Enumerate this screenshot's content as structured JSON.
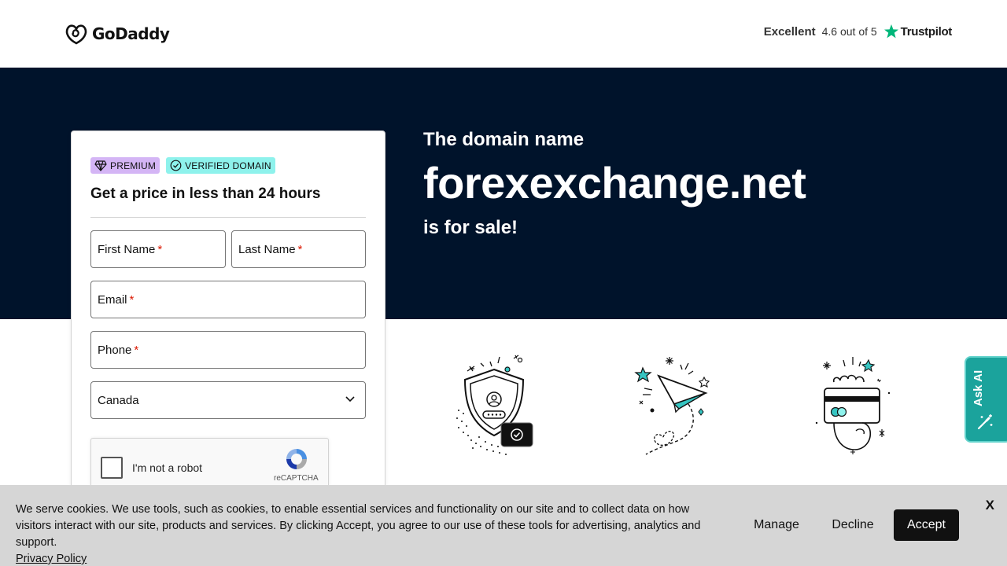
{
  "header": {
    "logo_text": "GoDaddy",
    "trustpilot": {
      "rating_word": "Excellent",
      "score_text": "4.6 out of 5",
      "brand": "Trustpilot"
    }
  },
  "hero": {
    "line1": "The domain name",
    "domain": "forexexchange.net",
    "line2": "is for sale!"
  },
  "form": {
    "badges": [
      {
        "label": "PREMIUM",
        "icon": "diamond-icon",
        "color": "#d4b5f5"
      },
      {
        "label": "VERIFIED DOMAIN",
        "icon": "check-circle-icon",
        "color": "#8ef2ec"
      }
    ],
    "title": "Get a price in less than 24 hours",
    "fields": {
      "first_name": {
        "label": "First Name",
        "required_mark": "*"
      },
      "last_name": {
        "label": "Last Name",
        "required_mark": "*"
      },
      "email": {
        "label": "Email",
        "required_mark": "*"
      },
      "phone": {
        "label": "Phone",
        "required_mark": "*"
      },
      "country": {
        "selected": "Canada"
      }
    },
    "recaptcha": {
      "label": "I'm not a robot",
      "brand": "reCAPTCHA"
    }
  },
  "illustrations": [
    {
      "icon": "secure-shield-icon"
    },
    {
      "icon": "paper-plane-icon"
    },
    {
      "icon": "credit-card-hand-icon"
    }
  ],
  "ask_ai": {
    "label": "Ask AI",
    "icon": "magic-wand-icon"
  },
  "cookie_banner": {
    "text": "We serve cookies. We use tools, such as cookies, to enable essential services and functionality on our site and to collect data on how visitors interact with our site, products and services. By clicking Accept, you agree to our use of these tools for advertising, analytics and support.",
    "privacy_link": "Privacy Policy",
    "manage_label": "Manage",
    "decline_label": "Decline",
    "accept_label": "Accept",
    "close_label": "X"
  },
  "colors": {
    "hero_bg": "#00132b",
    "accent_teal": "#1ba39c",
    "required_red": "#db1802",
    "trustpilot_green": "#00b67a"
  }
}
